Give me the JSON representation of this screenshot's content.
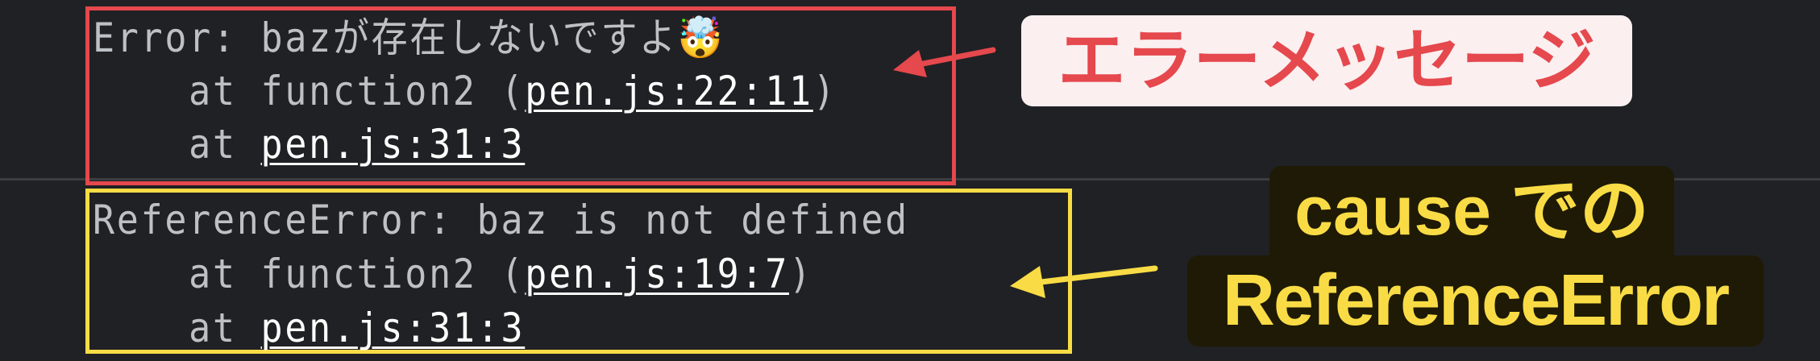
{
  "console": {
    "error": {
      "message": "Error: bazが存在しないですよ🤯",
      "stack": [
        {
          "prefix": "    at function2 (",
          "link": "pen.js:22:11",
          "suffix": ")"
        },
        {
          "prefix": "    at ",
          "link": "pen.js:31:3",
          "suffix": ""
        }
      ]
    },
    "cause": {
      "message": "ReferenceError: baz is not defined",
      "stack": [
        {
          "prefix": "    at function2 (",
          "link": "pen.js:19:7",
          "suffix": ")"
        },
        {
          "prefix": "    at ",
          "link": "pen.js:31:3",
          "suffix": ""
        }
      ]
    }
  },
  "annotations": {
    "error_label": "エラーメッセージ",
    "cause_label_line1": "cause での",
    "cause_label_line2": "ReferenceError",
    "colors": {
      "red": "#e5484d",
      "yellow": "#f9dc45",
      "background": "#202124"
    }
  }
}
